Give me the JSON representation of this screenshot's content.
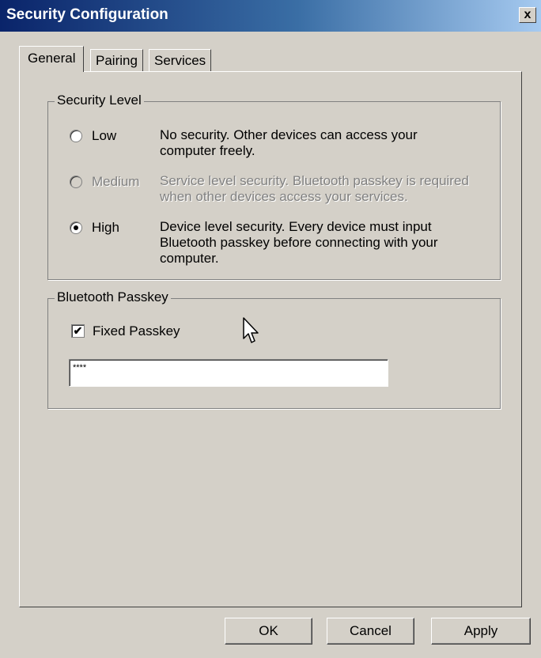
{
  "window": {
    "title": "Security Configuration",
    "close_label": "x"
  },
  "tabs": [
    {
      "label": "General",
      "active": true
    },
    {
      "label": "Pairing",
      "active": false
    },
    {
      "label": "Services",
      "active": false
    }
  ],
  "security_level": {
    "legend": "Security Level",
    "options": [
      {
        "label": "Low",
        "description_line1": "No security. Other devices can access your",
        "description_line2": "computer freely.",
        "selected": false,
        "enabled": true
      },
      {
        "label": "Medium",
        "description_line1": "Service level security. Bluetooth passkey is required",
        "description_line2": "when other devices access your services.",
        "selected": false,
        "enabled": false
      },
      {
        "label": "High",
        "description_line1": "Device level security. Every device must input",
        "description_line2": "Bluetooth passkey before connecting with your",
        "description_line3": "computer.",
        "selected": true,
        "enabled": true
      }
    ]
  },
  "passkey": {
    "legend": "Bluetooth Passkey",
    "fixed_label": "Fixed Passkey",
    "fixed_checked": true,
    "value": "****"
  },
  "buttons": {
    "ok": "OK",
    "cancel": "Cancel",
    "apply": "Apply"
  }
}
